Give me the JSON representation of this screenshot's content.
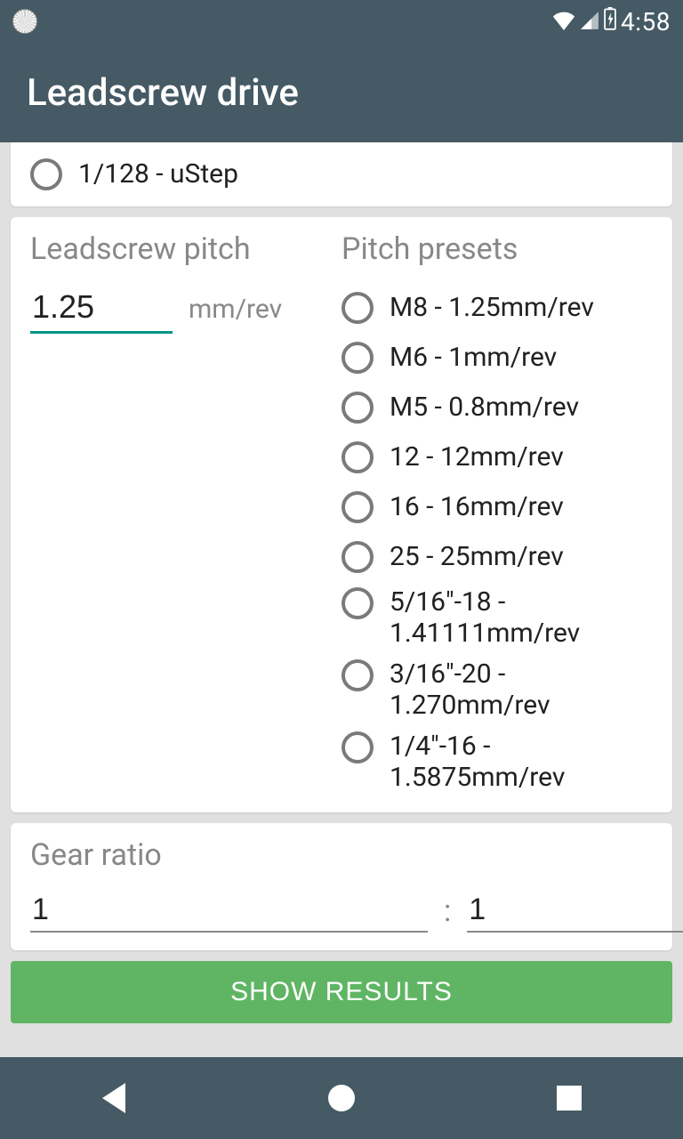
{
  "status": {
    "time": "4:58"
  },
  "appbar": {
    "title": "Leadscrew drive"
  },
  "ustep": {
    "option": "1/128 - uStep"
  },
  "pitch": {
    "label": "Leadscrew pitch",
    "value": "1.25",
    "unit": "mm/rev",
    "presets_label": "Pitch presets",
    "presets": [
      "M8 - 1.25mm/rev",
      "M6 - 1mm/rev",
      "M5 - 0.8mm/rev",
      "12 - 12mm/rev",
      "16 - 16mm/rev",
      "25 - 25mm/rev",
      "5/16\"-18 - 1.41111mm/rev",
      "3/16\"-20 - 1.270mm/rev",
      "1/4\"-16 - 1.5875mm/rev"
    ]
  },
  "gear": {
    "label": "Gear ratio",
    "left": "1",
    "sep": ":",
    "right": "1"
  },
  "button": {
    "show": "SHOW RESULTS"
  }
}
